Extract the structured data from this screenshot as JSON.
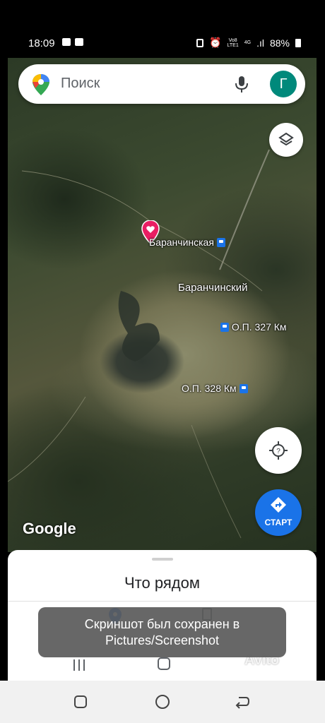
{
  "status_bar": {
    "time": "18:09",
    "battery": "88%",
    "network_top": "Vo8",
    "network_mid": "LTE1",
    "network_4g": "4G"
  },
  "search": {
    "placeholder": "Поиск",
    "avatar_letter": "Г"
  },
  "map": {
    "labels": {
      "station_main": "Баранчинская",
      "settlement": "Баранчинский",
      "stop_327": "О.П. 327 Км",
      "stop_328": "О.П. 328 Км"
    },
    "logo": "Google",
    "start_label": "СТАРТ"
  },
  "sheet": {
    "title": "Что рядом"
  },
  "toast": {
    "line1": "Скриншот был сохранен в",
    "line2": "Pictures/Screenshot"
  },
  "watermark": "Avito",
  "colors": {
    "accent": "#1a73e8",
    "avatar": "#00897b",
    "pin": "#e91e63"
  },
  "icons": [
    "maps-logo-icon",
    "mic-icon",
    "layers-icon",
    "locate-icon",
    "directions-icon",
    "pin-icon",
    "rail-station-icon",
    "explore-icon",
    "saved-icon"
  ]
}
